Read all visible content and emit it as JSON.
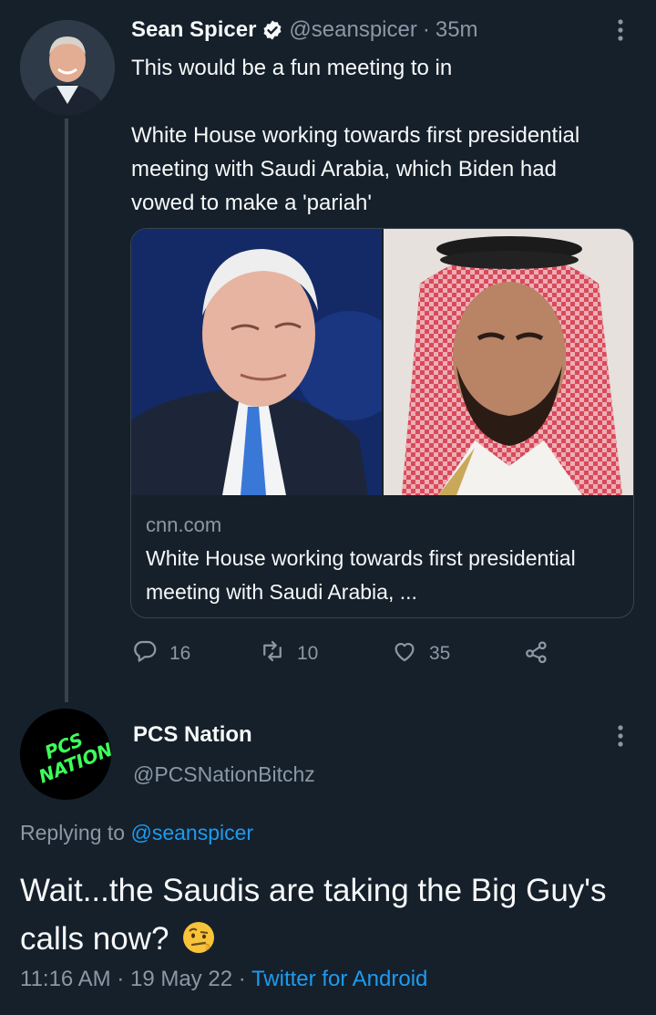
{
  "tweet": {
    "author_name": "Sean Spicer",
    "author_handle": "@seanspicer",
    "time": "35m",
    "separator": "·",
    "text": "This would be a fun meeting to in\n\nWhite House working towards first presidential meeting with Saudi Arabia, which Biden had vowed to make a 'pariah'",
    "card": {
      "domain": "cnn.com",
      "title": "White House working towards first presidential meeting with Saudi Arabia, ..."
    },
    "actions": {
      "replies": "16",
      "retweets": "10",
      "likes": "35"
    },
    "icons": [
      "verified-icon",
      "more-icon",
      "reply-icon",
      "retweet-icon",
      "like-icon",
      "share-icon"
    ]
  },
  "reply": {
    "author_name": "PCS Nation",
    "author_handle": "@PCSNationBitchz",
    "avatar_text": "PCS NATION",
    "replying_prefix": "Replying to",
    "replying_to": "@seanspicer",
    "text": "Wait...the Saudis are taking the Big Guy's calls now?",
    "emoji": "🤨",
    "time": "11:16 AM",
    "date": "19 May 22",
    "separator": "·",
    "source": "Twitter for Android"
  },
  "colors": {
    "background": "#15202b",
    "text": "#f7f9f9",
    "secondary": "#8b98a5",
    "accent": "#1d9bf0",
    "avatar_text": "#3dff5a"
  }
}
